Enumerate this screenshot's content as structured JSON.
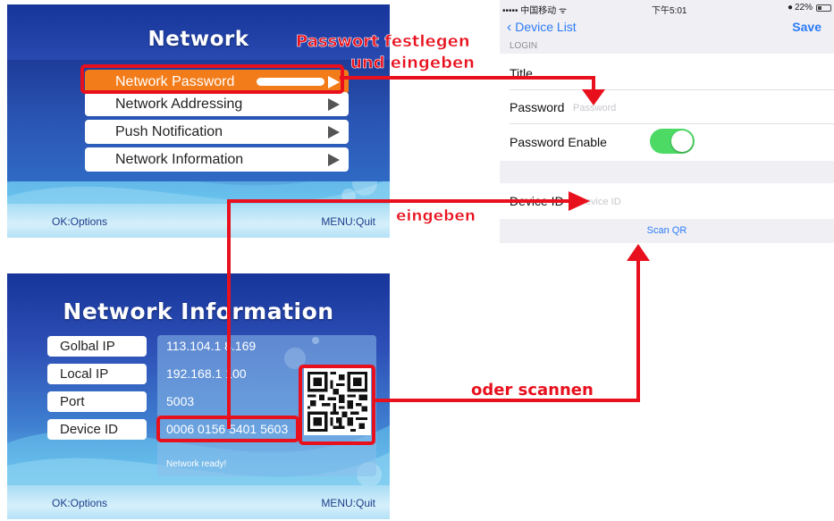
{
  "colors": {
    "annotation": "#e8101d",
    "tv_dark": "#17359a",
    "selected": "#f37c1a",
    "ios_blue": "#2d7cf6",
    "toggle_on": "#4cd964"
  },
  "tv_network": {
    "title": "Network",
    "menu": [
      {
        "label": "Network Password",
        "selected": true
      },
      {
        "label": "Network Addressing",
        "selected": false
      },
      {
        "label": "Push Notification",
        "selected": false
      },
      {
        "label": "Network Information",
        "selected": false
      }
    ],
    "footer_left": "OK:Options",
    "footer_right": "MENU:Quit"
  },
  "tv_info": {
    "title": "Network Information",
    "labels": [
      "Golbal IP",
      "Local IP",
      "Port",
      "Device ID"
    ],
    "values": [
      "113.104.1 8.169",
      "192.168.1 100",
      "5003",
      "0006 0156 5401 5603"
    ],
    "status": "Network ready!",
    "footer_left": "OK:Options",
    "footer_right": "MENU:Quit"
  },
  "phone": {
    "carrier": "••••• 中国移动 ᯤ",
    "time": "下午5:01",
    "battery": "22%",
    "nav_back": "Device List",
    "nav_save": "Save",
    "section": "LOGIN",
    "title_label": "Title",
    "password_label": "Password",
    "password_placeholder": "Password",
    "password_enable_label": "Password Enable",
    "password_enabled": true,
    "device_id_label": "Device ID",
    "device_id_placeholder": "Device ID",
    "scan_qr": "Scan QR"
  },
  "annotations": {
    "set_password_1": "Passwort festlegen",
    "set_password_2": "und eingeben",
    "enter": "eingeben",
    "or_scan": "oder scannen"
  }
}
